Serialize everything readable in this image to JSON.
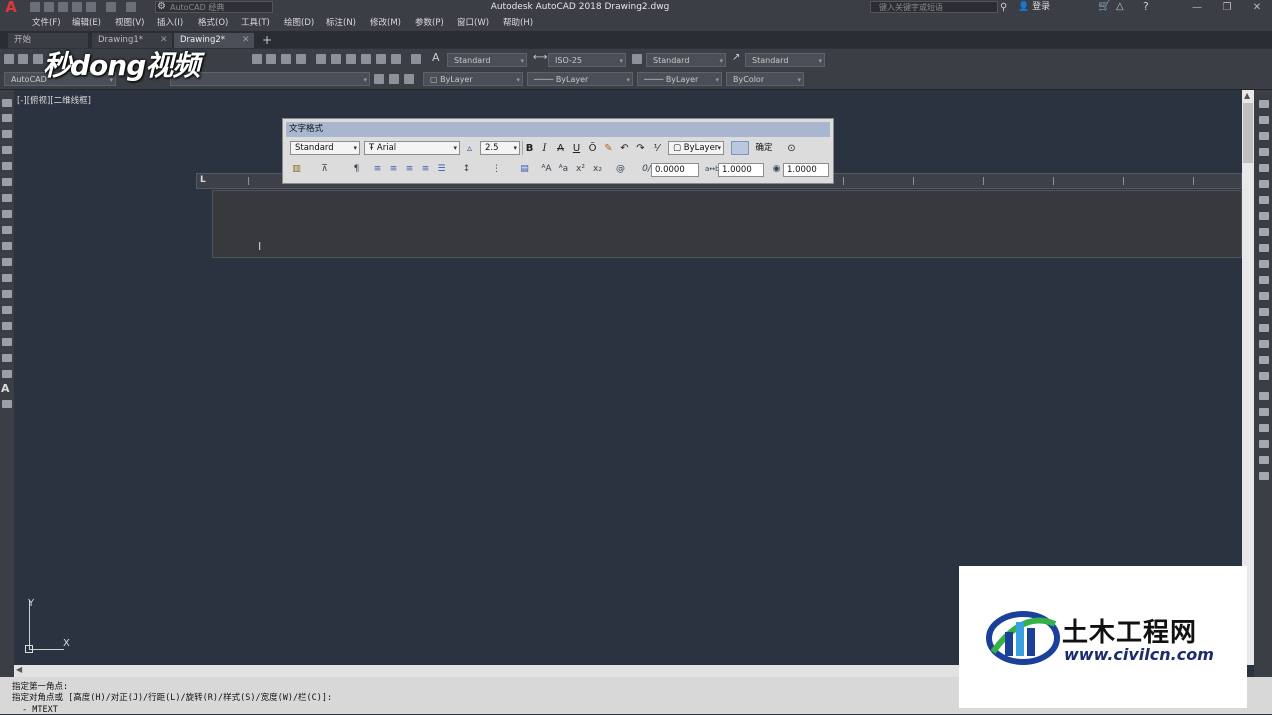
{
  "window": {
    "title": "Autodesk AutoCAD 2018    Drawing2.dwg",
    "workspace": "AutoCAD 经典",
    "search_placeholder": "键入关键字或短语",
    "login": "登录"
  },
  "menu": [
    "文件(F)",
    "编辑(E)",
    "视图(V)",
    "插入(I)",
    "格式(O)",
    "工具(T)",
    "绘图(D)",
    "标注(N)",
    "修改(M)",
    "参数(P)",
    "窗口(W)",
    "帮助(H)"
  ],
  "tabs": [
    {
      "label": "开始"
    },
    {
      "label": "Drawing1*"
    },
    {
      "label": "Drawing2*"
    }
  ],
  "toolbar": {
    "text_style": "Standard",
    "dim_style": "ISO-25",
    "table_style": "Standard",
    "mleader_style": "Standard",
    "workspace_short": "AutoCAD",
    "layer": "ByLayer",
    "linetype": "ByLayer",
    "lineweight": "ByLayer",
    "plotstyle": "ByColor"
  },
  "watermark": "秒dong视频",
  "viewport_label": "[-][俯视][二维线框]",
  "text_format": {
    "title": "文字格式",
    "style": "Standard",
    "font": "Arial",
    "height": "2.5",
    "bold": "B",
    "italic": "I",
    "strike": "A",
    "underline": "U",
    "overline": "Ō",
    "color": "ByLayer",
    "ok": "确定",
    "oblique": "0.0000",
    "tracking": "1.0000",
    "width_factor": "1.0000"
  },
  "ruler_label": "L",
  "ucs": {
    "y": "Y",
    "x": "X"
  },
  "command": {
    "line1": "指定第一角点:",
    "line2": "指定对角点或 [高度(H)/对正(J)/行距(L)/旋转(R)/样式(S)/宽度(W)/栏(C)]:",
    "line3": "- MTEXT"
  },
  "corner_logo": {
    "name": "土木工程网",
    "url": "www.civilcn.com"
  }
}
